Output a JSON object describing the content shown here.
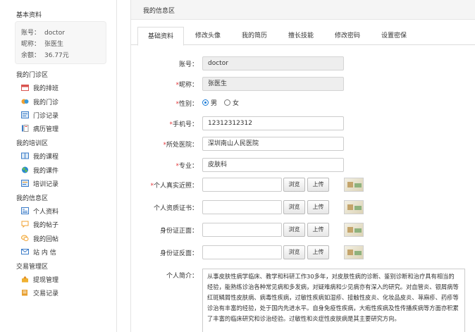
{
  "sidebar": {
    "basic_title": "基本资料",
    "profile": {
      "account_label": "账号：",
      "account_value": "doctor",
      "nickname_label": "昵称：",
      "nickname_value": "张医生",
      "balance_label": "余额：",
      "balance_value": "36.77元"
    },
    "sections": [
      {
        "title": "我的门诊区",
        "items": [
          {
            "label": "我的排班",
            "icon": "calendar-icon"
          },
          {
            "label": "我的门诊",
            "icon": "clinic-icon"
          },
          {
            "label": "门诊记录",
            "icon": "record-icon"
          },
          {
            "label": "病历管理",
            "icon": "medical-record-icon"
          }
        ]
      },
      {
        "title": "我的培训区",
        "items": [
          {
            "label": "我的课程",
            "icon": "book-icon"
          },
          {
            "label": "我的课件",
            "icon": "courseware-icon"
          },
          {
            "label": "培训记录",
            "icon": "training-record-icon"
          }
        ]
      },
      {
        "title": "我的信息区",
        "items": [
          {
            "label": "个人资料",
            "icon": "profile-icon"
          },
          {
            "label": "我的帖子",
            "icon": "post-icon"
          },
          {
            "label": "我的回帖",
            "icon": "reply-icon"
          },
          {
            "label": "站 内 信",
            "icon": "mail-icon"
          }
        ]
      },
      {
        "title": "交易管理区",
        "items": [
          {
            "label": "提现管理",
            "icon": "withdraw-icon"
          },
          {
            "label": "交易记录",
            "icon": "transaction-icon"
          }
        ]
      }
    ]
  },
  "main": {
    "header_title": "我的信息区",
    "tabs": [
      "基础资料",
      "修改头像",
      "我的简历",
      "擅长技能",
      "修改密码",
      "设置密保"
    ],
    "active_tab": 0
  },
  "form": {
    "account": {
      "label": "账号：",
      "value": "doctor"
    },
    "nickname": {
      "label": "昵称：",
      "value": "张医生"
    },
    "gender": {
      "label": "性别：",
      "male": "男",
      "female": "女",
      "selected": "男"
    },
    "phone": {
      "label": "手机号：",
      "value": "12312312312"
    },
    "hospital": {
      "label": "所处医院：",
      "value": "深圳南山人民医院"
    },
    "specialty": {
      "label": "专业：",
      "value": "皮肤科"
    },
    "photo": {
      "label": "个人真实近照："
    },
    "certificate": {
      "label": "个人资质证书："
    },
    "id_front": {
      "label": "身份证正面："
    },
    "id_back": {
      "label": "身份证反面："
    },
    "browse_label": "浏览",
    "upload_label": "上传",
    "required_mark": "*",
    "intro": {
      "label": "个人简介：",
      "value": "从事皮肤性病学临床、教学和科研工作30多年，对皮肤性病的诊断、鉴别诊断和治疗具有相当的经验，能熟练诊治各种常见病和多发病，对疑难病和少见病亦有深入的研究。对血管炎、银屑病等红斑鳞屑性皮肤病、病毒性疾病，过敏性疾病如湿疹、接触性皮炎、化妆品皮炎、荨麻疹、药疹等诊治有丰富的经验，处于国内先进水平。自身免疫性疾病，大疱性疾病及性传播疾病等方面亦积累了丰富的临床研究和诊治经验。过敏性和炎症性皮肤病是其主要研究方向。"
    }
  },
  "colors": {
    "accent_blue": "#1a7bd6",
    "required_red": "#e4393c",
    "readonly_bg": "#eeeeee"
  }
}
